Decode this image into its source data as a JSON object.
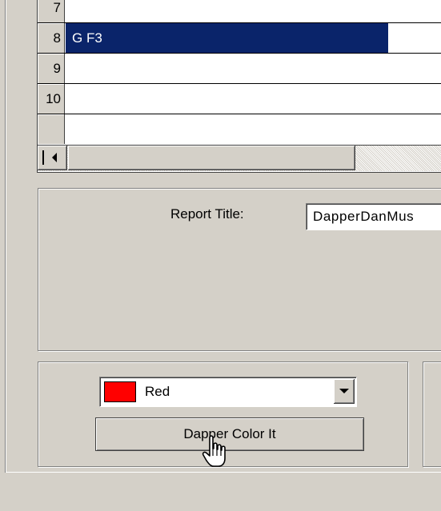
{
  "grid": {
    "rows": [
      {
        "number": "7",
        "value": ""
      },
      {
        "number": "8",
        "value": "G F3",
        "selected": true
      },
      {
        "number": "9",
        "value": ""
      },
      {
        "number": "10",
        "value": ""
      },
      {
        "number": "",
        "value": ""
      }
    ]
  },
  "report": {
    "label": "Report Title:",
    "value": "DapperDanMus"
  },
  "color": {
    "selected": "Red",
    "swatch_color": "#ff0000",
    "button_label": "Dapper Color It"
  },
  "icons": {
    "cursor": "hand-pointer-icon",
    "scroll_left": "scroll-left-arrow-icon",
    "dropdown": "chevron-down-icon"
  },
  "colors": {
    "selection": "#0a246a",
    "window_bg": "#d4d0c8"
  }
}
